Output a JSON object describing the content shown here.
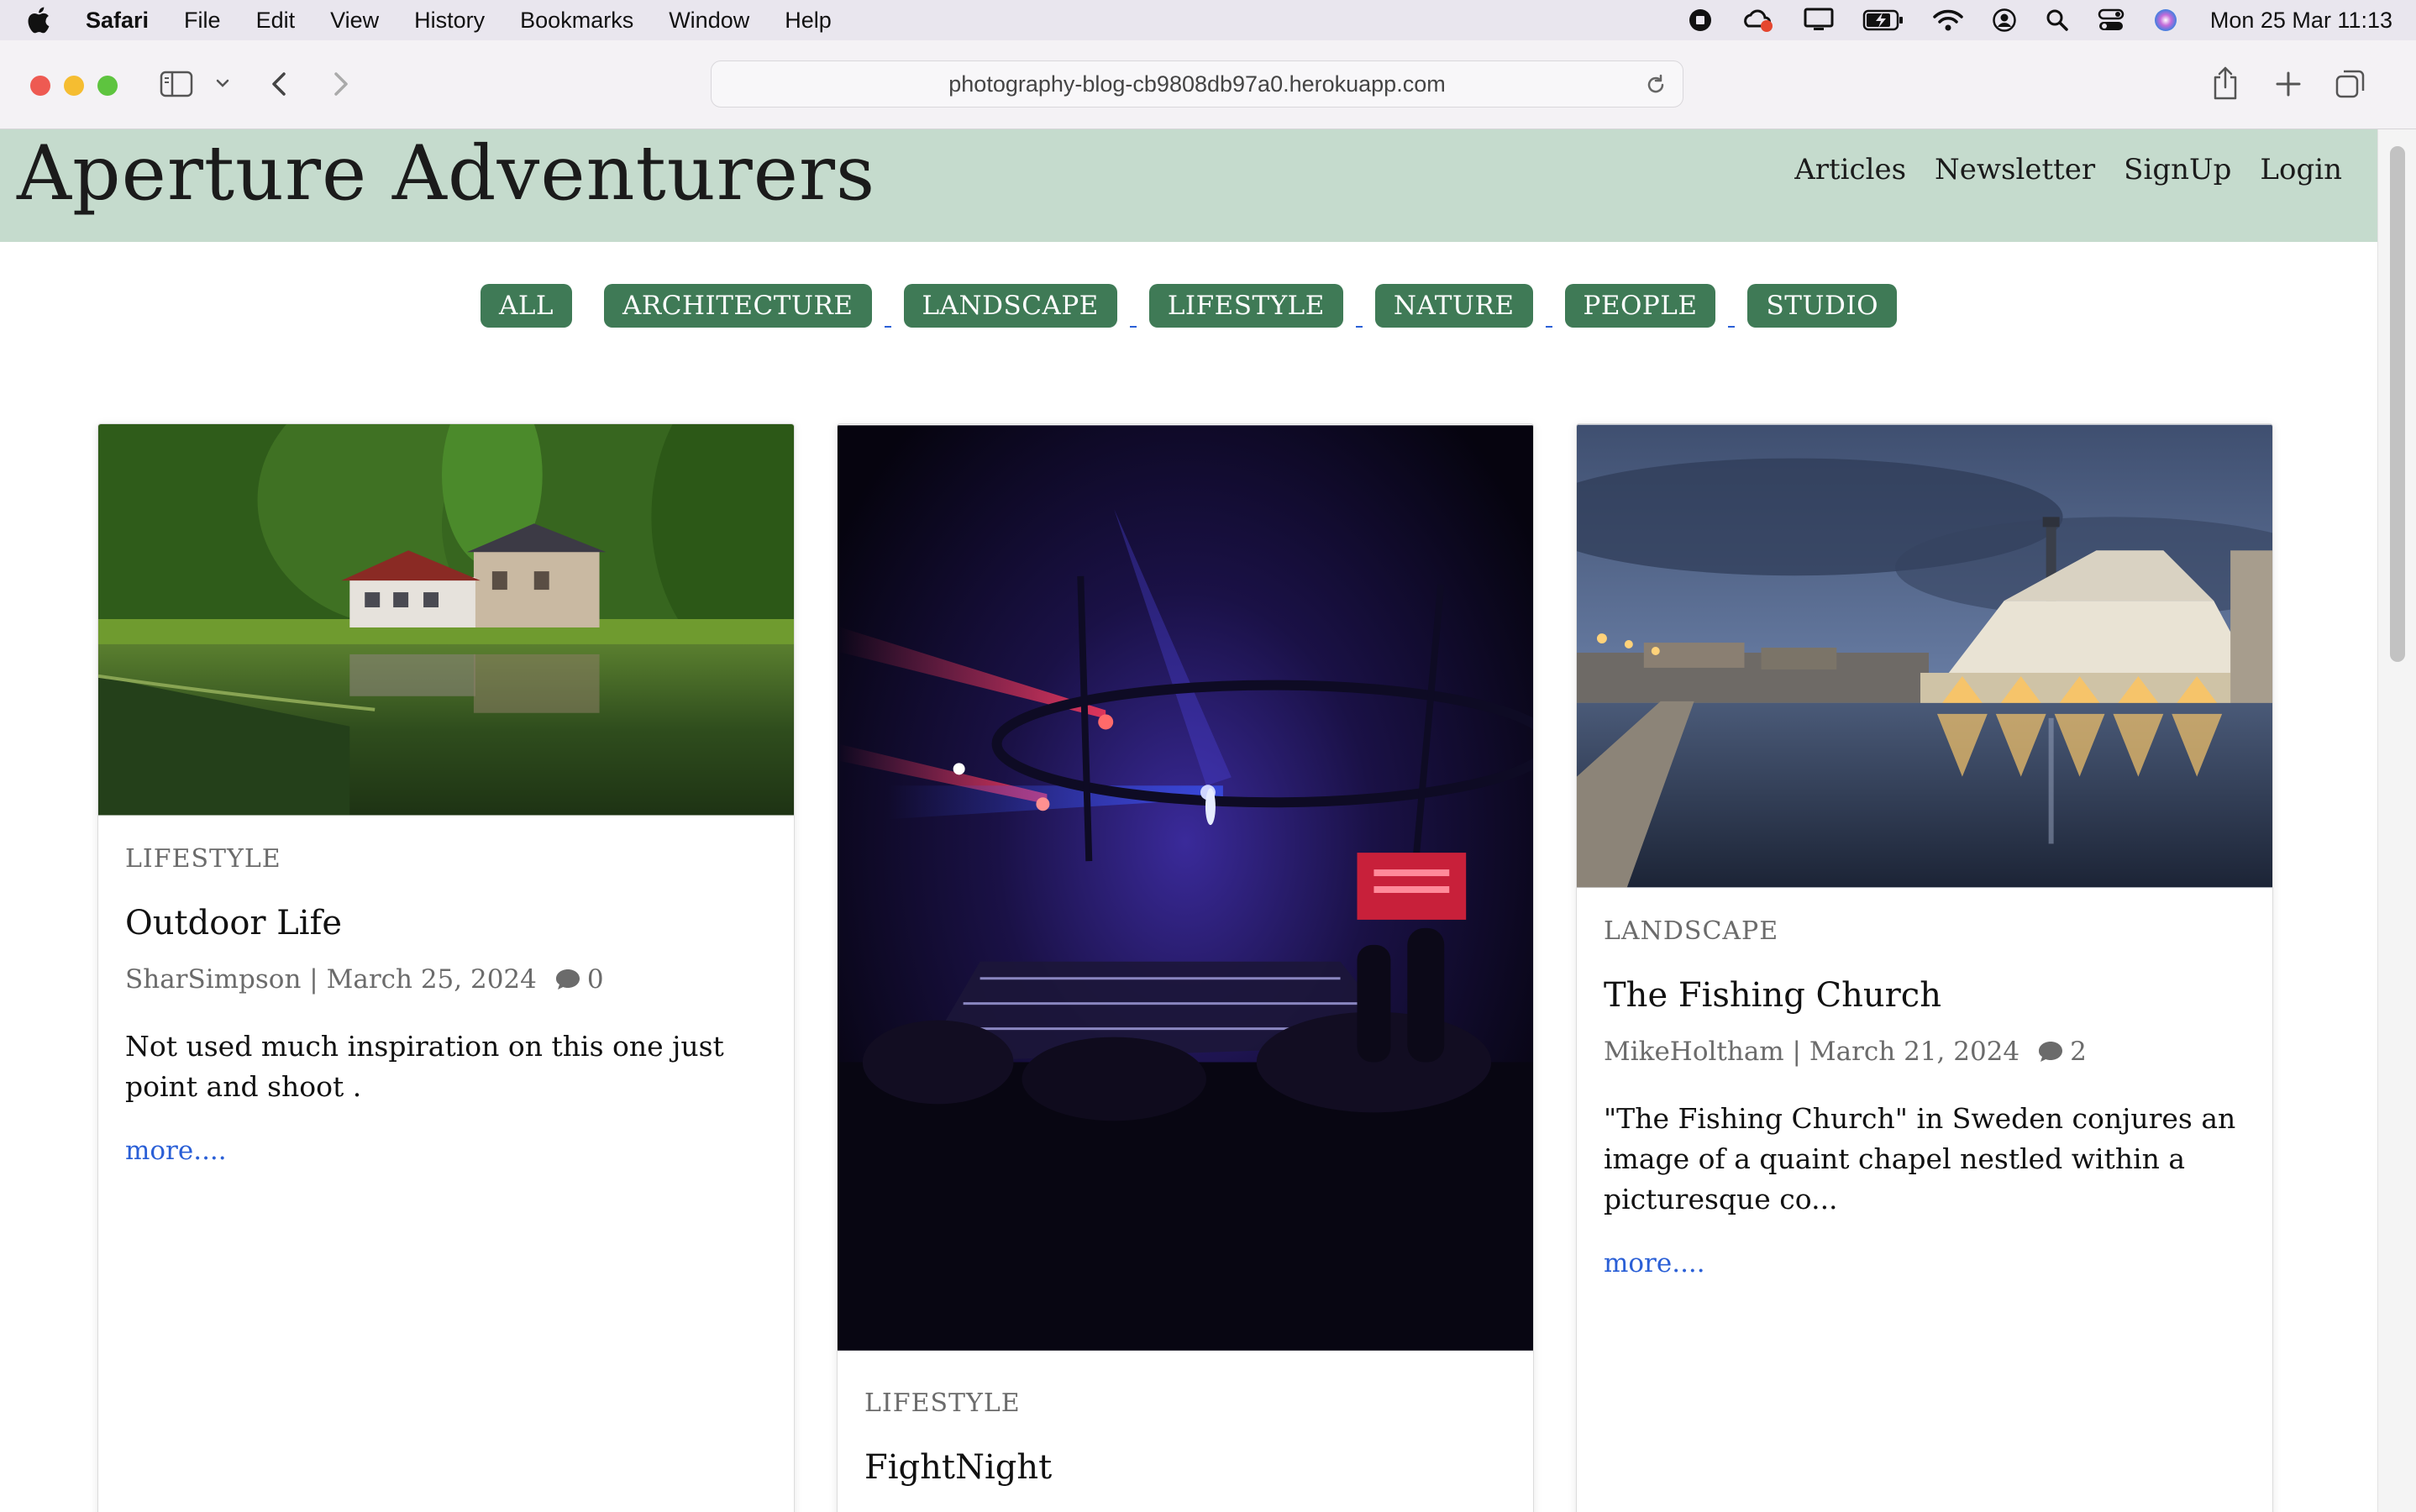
{
  "menubar": {
    "app": "Safari",
    "items": [
      "File",
      "Edit",
      "View",
      "History",
      "Bookmarks",
      "Window",
      "Help"
    ],
    "clock": "Mon 25 Mar  11:13"
  },
  "browser": {
    "url": "photography-blog-cb9808db97a0.herokuapp.com"
  },
  "site": {
    "brand": "Aperture Adventurers",
    "nav": [
      "Articles",
      "Newsletter",
      "SignUp",
      "Login"
    ],
    "categories": [
      "ALL",
      "ARCHITECTURE",
      "LANDSCAPE",
      "LIFESTYLE",
      "NATURE",
      "PEOPLE",
      "STUDIO"
    ],
    "accent": "#3f7a56",
    "header_bg": "#c5dbcd"
  },
  "posts": [
    {
      "category": "LIFESTYLE",
      "title": "Outdoor Life",
      "author": "SharSimpson",
      "date": "March 25, 2024",
      "comments": "0",
      "excerpt": "Not used much inspiration on this one just point and shoot .",
      "more": "more...."
    },
    {
      "category": "LIFESTYLE",
      "title": "FightNight"
    },
    {
      "category": "LANDSCAPE",
      "title": "The Fishing Church",
      "author": "MikeHoltham",
      "date": "March 21, 2024",
      "comments": "2",
      "excerpt": "\"The Fishing Church\" in Sweden conjures an image of a quaint chapel nestled within a picturesque co...",
      "more": "more...."
    }
  ]
}
